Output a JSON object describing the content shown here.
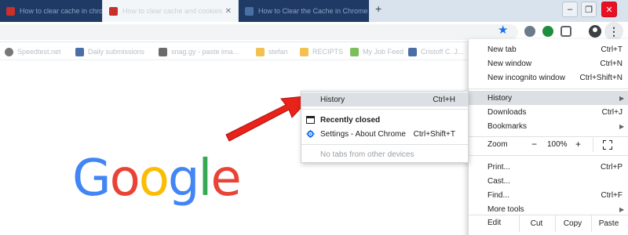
{
  "tabs": [
    {
      "title": "How to clear cache in chrome",
      "favicon_color": "#c9302c",
      "style": "blurred-dark"
    },
    {
      "title": "How to clear cache and cookies",
      "favicon_color": "#c9302c",
      "style": "active"
    },
    {
      "title": "How to Clear the Cache in Chrome",
      "favicon_color": "#4a6fa5",
      "style": "blurred-dark"
    }
  ],
  "new_tab_symbol": "+",
  "window_controls": {
    "minimize": "–",
    "maximize": "❐",
    "close": "✕"
  },
  "toolbar": {
    "bookmark_star": "★",
    "menu_symbol": "⋮"
  },
  "bookmarks": [
    {
      "label": "Speedtest.net",
      "icon_color": "#777777"
    },
    {
      "label": "Daily submissions",
      "icon_color": "#4a6fa5"
    },
    {
      "label": "snag.gy - paste ima...",
      "icon_color": "#6b6b6b"
    },
    {
      "label": "stefan",
      "icon_color": "#f2c14e"
    },
    {
      "label": "RECIPTS",
      "icon_color": "#f2c14e"
    },
    {
      "label": "My Job Feed",
      "icon_color": "#7cbf5a"
    },
    {
      "label": "Cristoff C. J...",
      "icon_color": "#4a6fa5"
    }
  ],
  "google_logo": [
    {
      "ch": "G",
      "color": "#4285f4"
    },
    {
      "ch": "o",
      "color": "#ea4335"
    },
    {
      "ch": "o",
      "color": "#fbbc05"
    },
    {
      "ch": "g",
      "color": "#4285f4"
    },
    {
      "ch": "l",
      "color": "#34a853"
    },
    {
      "ch": "e",
      "color": "#ea4335"
    }
  ],
  "menu": {
    "new_tab": {
      "label": "New tab",
      "shortcut": "Ctrl+T"
    },
    "new_window": {
      "label": "New window",
      "shortcut": "Ctrl+N"
    },
    "new_incognito": {
      "label": "New incognito window",
      "shortcut": "Ctrl+Shift+N"
    },
    "history": {
      "label": "History",
      "arrow": "▶"
    },
    "downloads": {
      "label": "Downloads",
      "shortcut": "Ctrl+J"
    },
    "bookmarks": {
      "label": "Bookmarks",
      "arrow": "▶"
    },
    "zoom": {
      "label": "Zoom",
      "minus": "−",
      "value": "100%",
      "plus": "+"
    },
    "print": {
      "label": "Print...",
      "shortcut": "Ctrl+P"
    },
    "cast": {
      "label": "Cast..."
    },
    "find": {
      "label": "Find...",
      "shortcut": "Ctrl+F"
    },
    "more_tools": {
      "label": "More tools",
      "arrow": "▶"
    },
    "edit": {
      "label": "Edit",
      "cut": "Cut",
      "copy": "Copy",
      "paste": "Paste"
    }
  },
  "history_submenu": {
    "history": {
      "label": "History",
      "shortcut": "Ctrl+H"
    },
    "recently_closed": {
      "label": "Recently closed"
    },
    "settings": {
      "label": "Settings - About Chrome",
      "shortcut": "Ctrl+Shift+T"
    },
    "no_tabs": {
      "label": "No tabs from other devices"
    }
  },
  "colors": {
    "accent": "#1a73e8",
    "highlight": "#dcdfe3",
    "annotation_arrow": "#e8231a"
  }
}
